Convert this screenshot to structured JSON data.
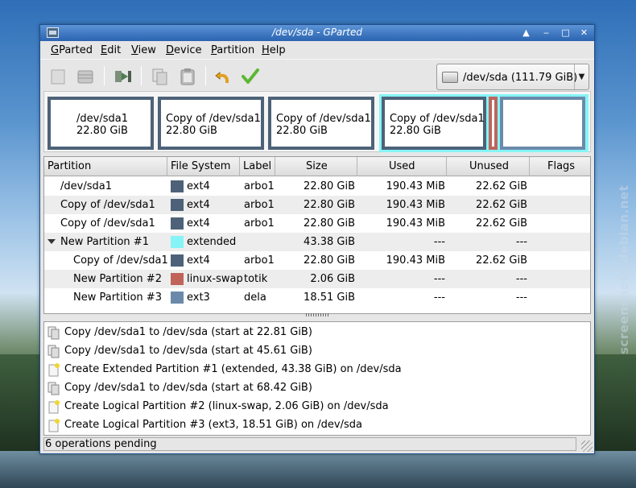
{
  "window": {
    "title": "/dev/sda - GParted"
  },
  "menubar": {
    "items": [
      "GParted",
      "Edit",
      "View",
      "Device",
      "Partition",
      "Help"
    ]
  },
  "toolbar": {
    "buttons": [
      {
        "name": "new-button",
        "icon": "new-partition-icon"
      },
      {
        "name": "delete-button",
        "icon": "delete-icon"
      },
      {
        "name": "resize-move-button",
        "icon": "resize-move-icon"
      },
      {
        "name": "copy-button",
        "icon": "copy-icon"
      },
      {
        "name": "paste-button",
        "icon": "paste-icon"
      },
      {
        "name": "undo-button",
        "icon": "undo-icon"
      },
      {
        "name": "apply-button",
        "icon": "apply-checkmark-icon"
      }
    ],
    "device": "/dev/sda   (111.79 GiB)"
  },
  "diskmap": {
    "partitions": [
      {
        "name": "/dev/sda1",
        "size": "22.80 GiB"
      },
      {
        "name": "Copy of /dev/sda1",
        "size": "22.80 GiB"
      },
      {
        "name": "Copy of /dev/sda1",
        "size": "22.80 GiB"
      },
      {
        "name": "Copy of /dev/sda1",
        "size": "22.80 GiB"
      }
    ]
  },
  "table": {
    "headers": [
      "Partition",
      "File System",
      "Label",
      "Size",
      "Used",
      "Unused",
      "Flags"
    ],
    "rows": [
      {
        "partition": "/dev/sda1",
        "fs": "ext4",
        "label": "arbo1",
        "size": "22.80 GiB",
        "used": "190.43 MiB",
        "unused": "22.62 GiB"
      },
      {
        "partition": "Copy of /dev/sda1",
        "fs": "ext4",
        "label": "arbo1",
        "size": "22.80 GiB",
        "used": "190.43 MiB",
        "unused": "22.62 GiB"
      },
      {
        "partition": "Copy of /dev/sda1",
        "fs": "ext4",
        "label": "arbo1",
        "size": "22.80 GiB",
        "used": "190.43 MiB",
        "unused": "22.62 GiB"
      },
      {
        "partition": "New Partition #1",
        "fs": "extended",
        "label": "",
        "size": "43.38 GiB",
        "used": "---",
        "unused": "---"
      },
      {
        "partition": "Copy of /dev/sda1",
        "fs": "ext4",
        "label": "arbo1",
        "size": "22.80 GiB",
        "used": "190.43 MiB",
        "unused": "22.62 GiB"
      },
      {
        "partition": "New Partition #2",
        "fs": "linux-swap",
        "label": "totik",
        "size": "2.06 GiB",
        "used": "---",
        "unused": "---"
      },
      {
        "partition": "New Partition #3",
        "fs": "ext3",
        "label": "dela",
        "size": "18.51 GiB",
        "used": "---",
        "unused": "---"
      }
    ],
    "fs_colors": {
      "ext4": "#4d6278",
      "extended": "#86f4f6",
      "linux-swap": "#c0645a",
      "ext3": "#6b8aaa"
    }
  },
  "operations": [
    "Copy /dev/sda1 to /dev/sda (start at 22.81 GiB)",
    "Copy /dev/sda1 to /dev/sda (start at 45.61 GiB)",
    "Create Extended Partition #1 (extended, 43.38 GiB) on /dev/sda",
    "Copy /dev/sda1 to /dev/sda (start at 68.42 GiB)",
    "Create Logical Partition #2 (linux-swap, 2.06 GiB) on /dev/sda",
    "Create Logical Partition #3 (ext3, 18.51 GiB) on /dev/sda"
  ],
  "statusbar": {
    "text": "6 operations pending"
  },
  "watermark": "screenshots.debian.net"
}
